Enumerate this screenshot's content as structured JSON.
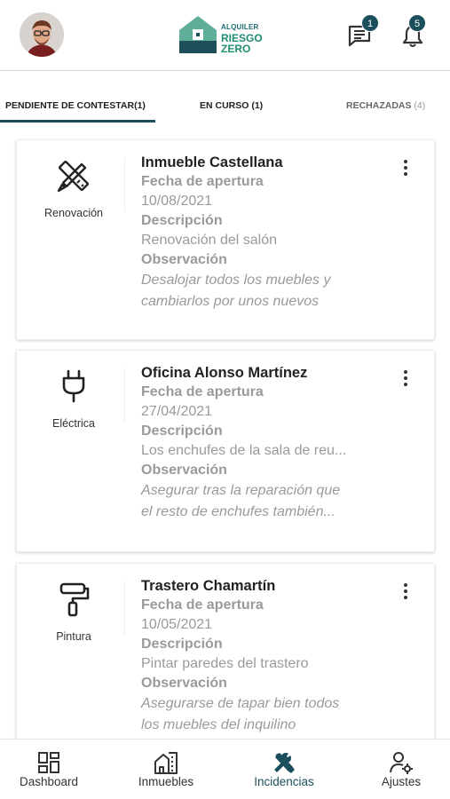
{
  "header": {
    "avatar": "user-avatar",
    "logo": {
      "line1": "ALQUILER",
      "line2": "RIESGO",
      "line3": "ZERO"
    },
    "messages_badge": "1",
    "notifications_badge": "5"
  },
  "tabs": [
    {
      "label": "PENDIENTE DE CONTESTAR(1)",
      "active": true
    },
    {
      "label": "EN CURSO (1)",
      "active": false
    },
    {
      "label": "RECHAZADAS",
      "count": "(4)",
      "active": false
    }
  ],
  "incidents": [
    {
      "icon": "ruler-pencil-icon",
      "category": "Renovación",
      "title": "Inmueble Castellana",
      "date_label": "Fecha de apertura",
      "date": "10/08/2021",
      "desc_label": "Descripción",
      "description": "Renovación del salón",
      "obs_label": "Observación",
      "observation": "Desalojar todos los muebles y\ncambiarlos por unos nuevos"
    },
    {
      "icon": "plug-icon",
      "category": "Eléctrica",
      "title": "Oficina Alonso Martínez",
      "date_label": "Fecha de apertura",
      "date": "27/04/2021",
      "desc_label": "Descripción",
      "description": "Los enchufes de la sala de reu...",
      "obs_label": "Observación",
      "observation": "Asegurar tras la reparación que\n el resto de enchufes también..."
    },
    {
      "icon": "paint-roller-icon",
      "category": "Pintura",
      "title": "Trastero Chamartín",
      "date_label": "Fecha de apertura",
      "date": "10/05/2021",
      "desc_label": "Descripción",
      "description": "Pintar paredes del trastero",
      "obs_label": "Observación",
      "observation": "Asegurarse de tapar bien todos\nlos muebles del inquilino"
    }
  ],
  "bottom_nav": [
    {
      "label": "Dashboard",
      "icon": "dashboard-icon",
      "active": false
    },
    {
      "label": "Inmuebles",
      "icon": "building-icon",
      "active": false
    },
    {
      "label": "Incidencias",
      "icon": "tools-icon",
      "active": true
    },
    {
      "label": "Ajustes",
      "icon": "user-settings-icon",
      "active": false
    }
  ],
  "colors": {
    "primary": "#1b4f5c",
    "brand_green": "#1f8c73",
    "muted_text": "#9a9a9a"
  }
}
